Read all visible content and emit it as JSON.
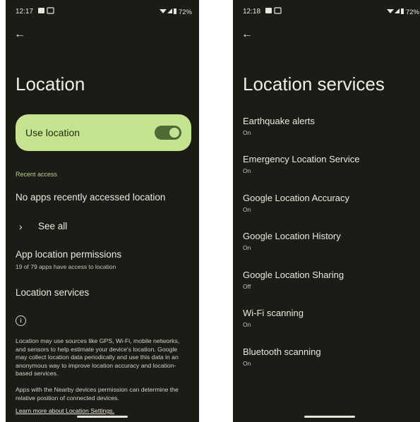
{
  "left": {
    "status": {
      "time": "12:17",
      "battery": "72%"
    },
    "title": "Location",
    "toggle_label": "Use location",
    "recent_access_header": "Recent access",
    "no_apps_text": "No apps recently accessed location",
    "see_all_label": "See all",
    "app_permissions": {
      "title": "App location permissions",
      "subtitle": "19 of 79 apps have access to location"
    },
    "location_services_label": "Location services",
    "info_icon": "info-icon",
    "info_para1": "Location may use sources like GPS, Wi-Fi, mobile networks, and sensors to help estimate your device's location. Google may collect location data periodically and use this data in an anonymous way to improve location accuracy and location-based services.",
    "info_para2": "Apps with the Nearby devices permission can determine the relative position of connected devices.",
    "learn_more_link": "Learn more about Location Settings."
  },
  "right": {
    "status": {
      "time": "12:18",
      "battery": "72%"
    },
    "title": "Location services",
    "items": [
      {
        "title": "Earthquake alerts",
        "status": "On"
      },
      {
        "title": "Emergency Location Service",
        "status": "On"
      },
      {
        "title": "Google Location Accuracy",
        "status": "On"
      },
      {
        "title": "Google Location History",
        "status": "On"
      },
      {
        "title": "Google Location Sharing",
        "status": "Off"
      },
      {
        "title": "Wi-Fi scanning",
        "status": "On"
      },
      {
        "title": "Bluetooth scanning",
        "status": "On"
      }
    ]
  },
  "colors": {
    "background": "#1c1c17",
    "accent": "#c6e48f",
    "section_header": "#b8d38c"
  }
}
